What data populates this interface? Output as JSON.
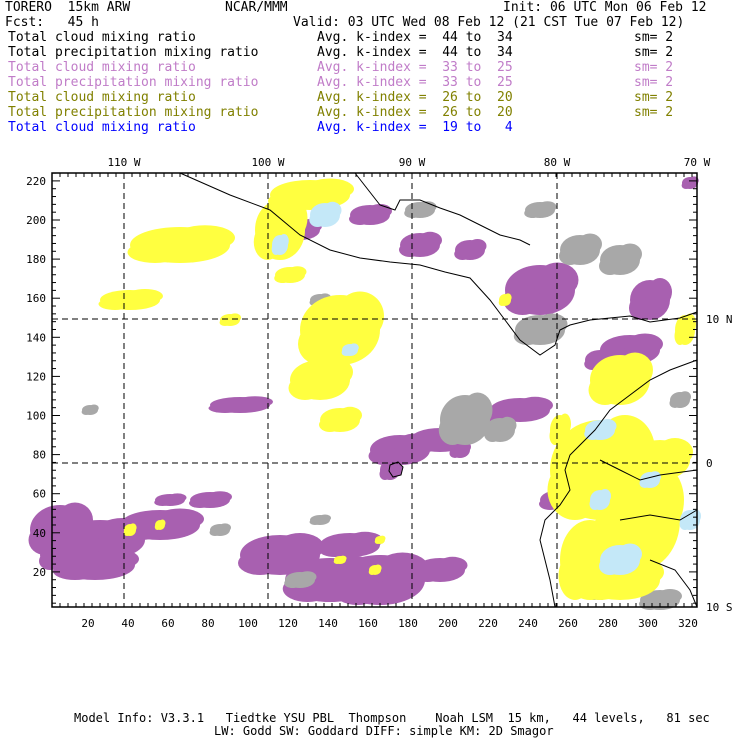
{
  "header": {
    "model": "TORERO  15km ARW",
    "org": "NCAR/MMM",
    "init": "Init: 06 UTC Mon 06 Feb 12",
    "fcst": "Fcst:   45 h",
    "valid": "Valid: 03 UTC Wed 08 Feb 12 (21 CST Tue 07 Feb 12)"
  },
  "legend": [
    {
      "field": "Total cloud mixing ratio",
      "range": "Avg. k-index =  44 to  34",
      "sm": "sm= 2",
      "color": "#000000"
    },
    {
      "field": "Total precipitation mixing ratio",
      "range": "Avg. k-index =  44 to  34",
      "sm": "sm= 2",
      "color": "#000000"
    },
    {
      "field": "Total cloud mixing ratio",
      "range": "Avg. k-index =  33 to  25",
      "sm": "sm= 2",
      "color": "#c07cc8"
    },
    {
      "field": "Total precipitation mixing ratio",
      "range": "Avg. k-index =  33 to  25",
      "sm": "sm= 2",
      "color": "#c07cc8"
    },
    {
      "field": "Total cloud mixing ratio",
      "range": "Avg. k-index =  26 to  20",
      "sm": "sm= 2",
      "color": "#808000"
    },
    {
      "field": "Total precipitation mixing ratio",
      "range": "Avg. k-index =  26 to  20",
      "sm": "sm= 2",
      "color": "#808000"
    },
    {
      "field": "Total cloud mixing ratio",
      "range": "Avg. k-index =  19 to   4",
      "sm": "",
      "color": "#0000ff"
    }
  ],
  "axes": {
    "lon_labels": [
      "110 W",
      "100 W",
      "90 W",
      "80 W",
      "70 W"
    ],
    "lat_labels": [
      "10 N",
      "0",
      "10 S"
    ],
    "x_ticks": [
      "20",
      "40",
      "60",
      "80",
      "100",
      "120",
      "140",
      "160",
      "180",
      "200",
      "220",
      "240",
      "260",
      "280",
      "300",
      "320"
    ],
    "y_ticks": [
      "220",
      "200",
      "180",
      "160",
      "140",
      "120",
      "100",
      "80",
      "60",
      "40",
      "20"
    ]
  },
  "colors": {
    "purple": "#a860b0",
    "yellow": "#ffff40",
    "gray": "#a8a8a8",
    "lightblue": "#c4e8f8"
  },
  "footer": {
    "line1": "Model Info: V3.3.1   Tiedtke YSU PBL  Thompson    Noah LSM  15 km,   44 levels,   81 sec",
    "line2": "LW: Godd SW: Goddard DIFF: simple KM: 2D Smagor"
  }
}
